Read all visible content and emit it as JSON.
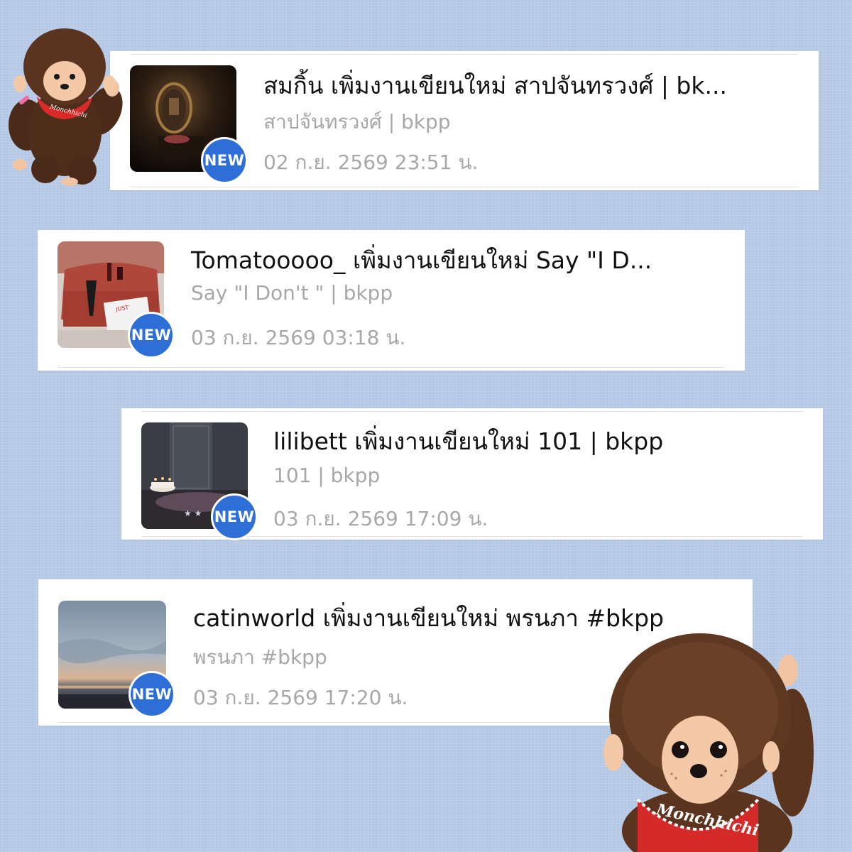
{
  "notifications": [
    {
      "title": "สมกิ้น เพิ่มงานเขียนใหม่ สาปจันทรวงศ์ | bk...",
      "subtitle": "สาปจันทรวงศ์ | bkpp",
      "time": "02 ก.ย. 2569 23:51 น.",
      "badge": "NEW",
      "thumbnail": "mirror-candle-image"
    },
    {
      "title": "Tomatooooo_ เพิ่มงานเขียนใหม่ Say \"I D...",
      "subtitle": "Say \"I Don't \" | bkpp",
      "time": "03 ก.ย. 2569 03:18 น.",
      "badge": "NEW",
      "thumbnail": "red-sofa-image"
    },
    {
      "title": "lilibett เพิ่มงานเขียนใหม่ 101 | bkpp",
      "subtitle": "101 | bkpp",
      "time": "03 ก.ย. 2569 17:09 น.",
      "badge": "NEW",
      "thumbnail": "birthday-cake-image"
    },
    {
      "title": "catinworld  เพิ่มงานเขียนใหม่ พรนภา #bkpp",
      "subtitle": "พรนภา #bkpp",
      "time": "03 ก.ย. 2569 17:20 น.",
      "badge": "NEW",
      "thumbnail": "sunset-sea-image"
    }
  ],
  "stickers": {
    "bib_text": "Monchhichi"
  },
  "colors": {
    "background": "#b8cbe6",
    "badge": "#2d6fd6",
    "title": "#111111",
    "meta": "#a8a8a8"
  }
}
